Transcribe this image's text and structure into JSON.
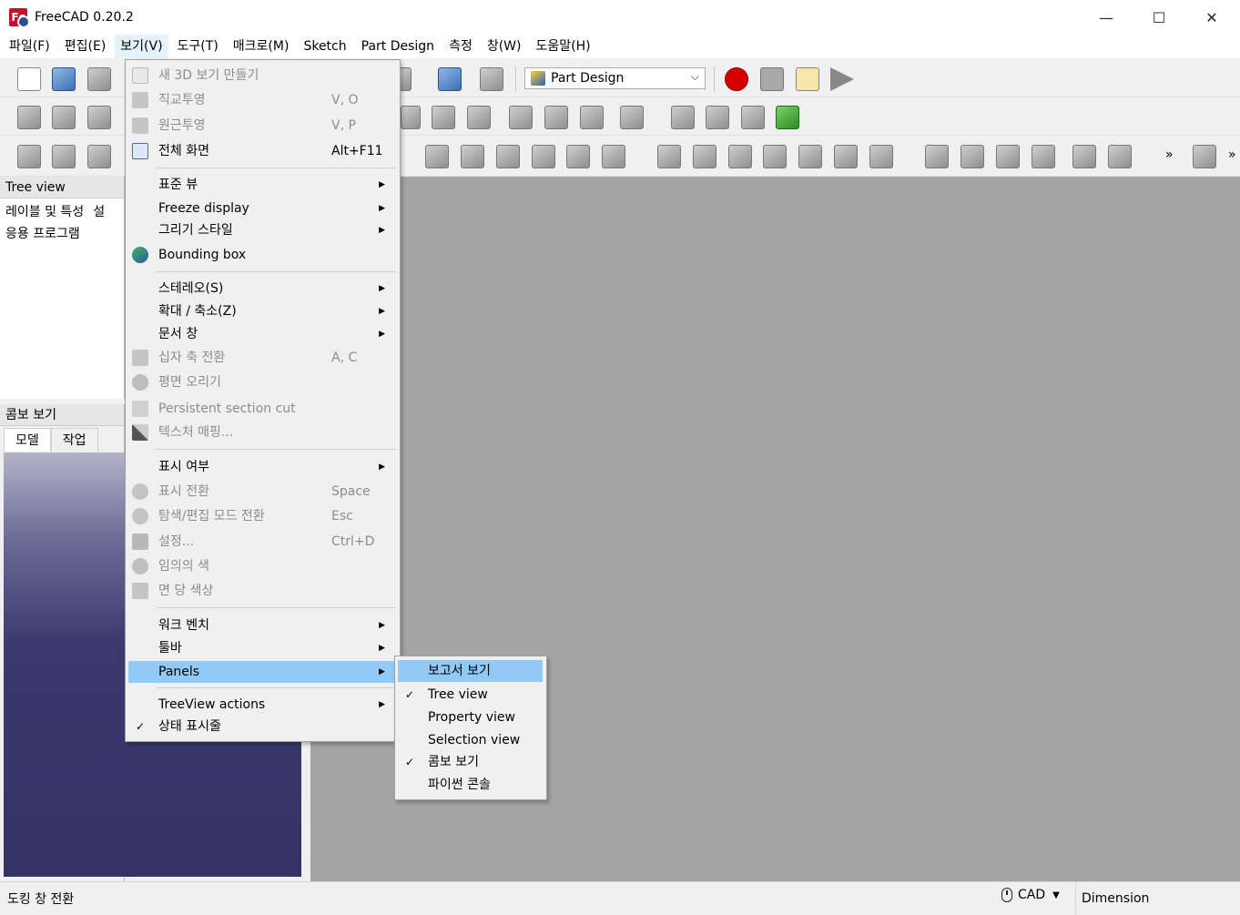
{
  "window": {
    "title": "FreeCAD 0.20.2",
    "logo": "Fc",
    "minimize": "—",
    "maximize": "☐",
    "close": "✕"
  },
  "menubar": [
    "파일(F)",
    "편집(E)",
    "보기(V)",
    "도구(T)",
    "매크로(M)",
    "Sketch",
    "Part Design",
    "측정",
    "창(W)",
    "도움말(H)"
  ],
  "workbench": {
    "selected": "Part Design"
  },
  "tree_view": {
    "title": "Tree view",
    "col_labels": "레이블 및 특성",
    "col_desc": "설",
    "app_node": "응용 프로그램"
  },
  "combo_view": {
    "title": "콤보 보기",
    "tabs": [
      "모델",
      "작업"
    ]
  },
  "status": {
    "message": "도킹 창 전환",
    "nav_style": "CAD",
    "units": "Dimension"
  },
  "view_menu": {
    "items": [
      {
        "label": "새 3D 보기 만들기",
        "shortcut": "",
        "disabled": true
      },
      {
        "label": "직교투영",
        "shortcut": "V, O",
        "disabled": true
      },
      {
        "label": "원근투영",
        "shortcut": "V, P",
        "disabled": true
      },
      {
        "label": "전체 화면",
        "shortcut": "Alt+F11",
        "disabled": false
      },
      {
        "label": "표준 뷰",
        "submenu": true
      },
      {
        "label": "Freeze display",
        "submenu": true
      },
      {
        "label": "그리기 스타일",
        "submenu": true
      },
      {
        "label": "Bounding box",
        "disabled": false
      },
      {
        "label": "스테레오(S)",
        "submenu": true
      },
      {
        "label": "확대 / 축소(Z)",
        "submenu": true
      },
      {
        "label": "문서 창",
        "submenu": true
      },
      {
        "label": "십자 축 전환",
        "shortcut": "A, C",
        "disabled": true
      },
      {
        "label": "평면 오리기",
        "disabled": true
      },
      {
        "label": "Persistent section cut",
        "disabled": true
      },
      {
        "label": "텍스처 매핑...",
        "disabled": true
      },
      {
        "label": "표시 여부",
        "submenu": true
      },
      {
        "label": "표시 전환",
        "shortcut": "Space",
        "disabled": true
      },
      {
        "label": "탐색/편집 모드 전환",
        "shortcut": "Esc",
        "disabled": true
      },
      {
        "label": "설정...",
        "shortcut": "Ctrl+D",
        "disabled": true
      },
      {
        "label": "임의의 색",
        "disabled": true
      },
      {
        "label": "면 당 색상",
        "disabled": true
      },
      {
        "label": "워크 벤치",
        "submenu": true
      },
      {
        "label": "툴바",
        "submenu": true
      },
      {
        "label": "Panels",
        "submenu": true,
        "highlighted": true
      },
      {
        "label": "TreeView actions",
        "submenu": true
      },
      {
        "label": "상태 표시줄",
        "checked": true
      }
    ]
  },
  "panels_submenu": {
    "items": [
      {
        "label": "보고서 보기",
        "checked": false,
        "highlighted": true
      },
      {
        "label": "Tree view",
        "checked": true
      },
      {
        "label": "Property view",
        "checked": false
      },
      {
        "label": "Selection view",
        "checked": false
      },
      {
        "label": "콤보 보기",
        "checked": true
      },
      {
        "label": "파이썬 콘솔",
        "checked": false
      }
    ]
  },
  "glyphs": {
    "check": "✓",
    "arrow": "▶",
    "chevron": "⌵",
    "caret": "▼",
    "overflow": "»"
  },
  "colors": {
    "menu_highlight": "#91c9f7",
    "viewport_bg": "#a4a4a4",
    "record_button": "#d40000"
  }
}
